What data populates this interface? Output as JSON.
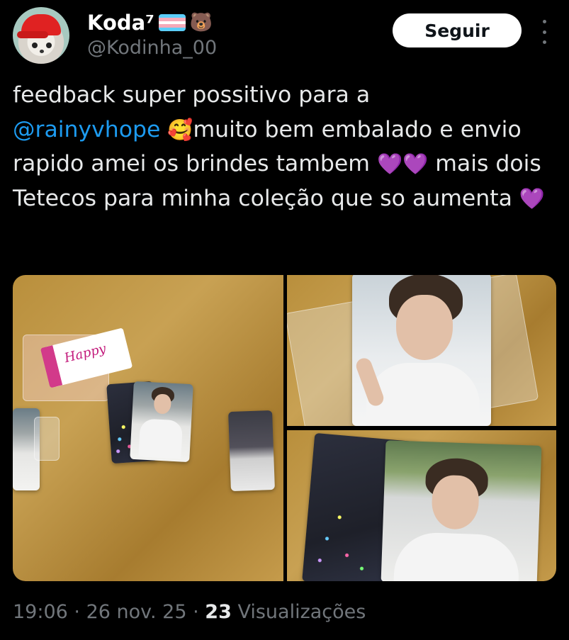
{
  "author": {
    "display_name": "Koda⁷",
    "handle": "@Kodinha_00",
    "badge_emoji": "🐻",
    "flag": "transgender-flag"
  },
  "follow_button": {
    "label": "Seguir"
  },
  "more_menu": {
    "icon": "more-vertical-icon"
  },
  "tweet": {
    "text_1": "feedback super possitivo para a",
    "mention": "@rainyvhope",
    "emoji_1": "🥰",
    "text_2": "muito bem embalado e envio rapido amei os brindes tambem",
    "emoji_2": "💜💜",
    "text_3": "mais dois Tetecos para minha coleção que so aumenta",
    "emoji_3": "💜"
  },
  "media": {
    "photos": [
      {
        "description_name": "photocards-on-table",
        "card_text": "Happy"
      },
      {
        "description_name": "photocard-closeup"
      },
      {
        "description_name": "photocard-with-holo-backing"
      }
    ]
  },
  "meta": {
    "time": "19:06",
    "date": "26 nov. 25",
    "views_count": "23",
    "views_label": "Visualizações"
  },
  "colors": {
    "mention": "#1d9bf0",
    "background": "#000000",
    "muted": "#71767b"
  }
}
